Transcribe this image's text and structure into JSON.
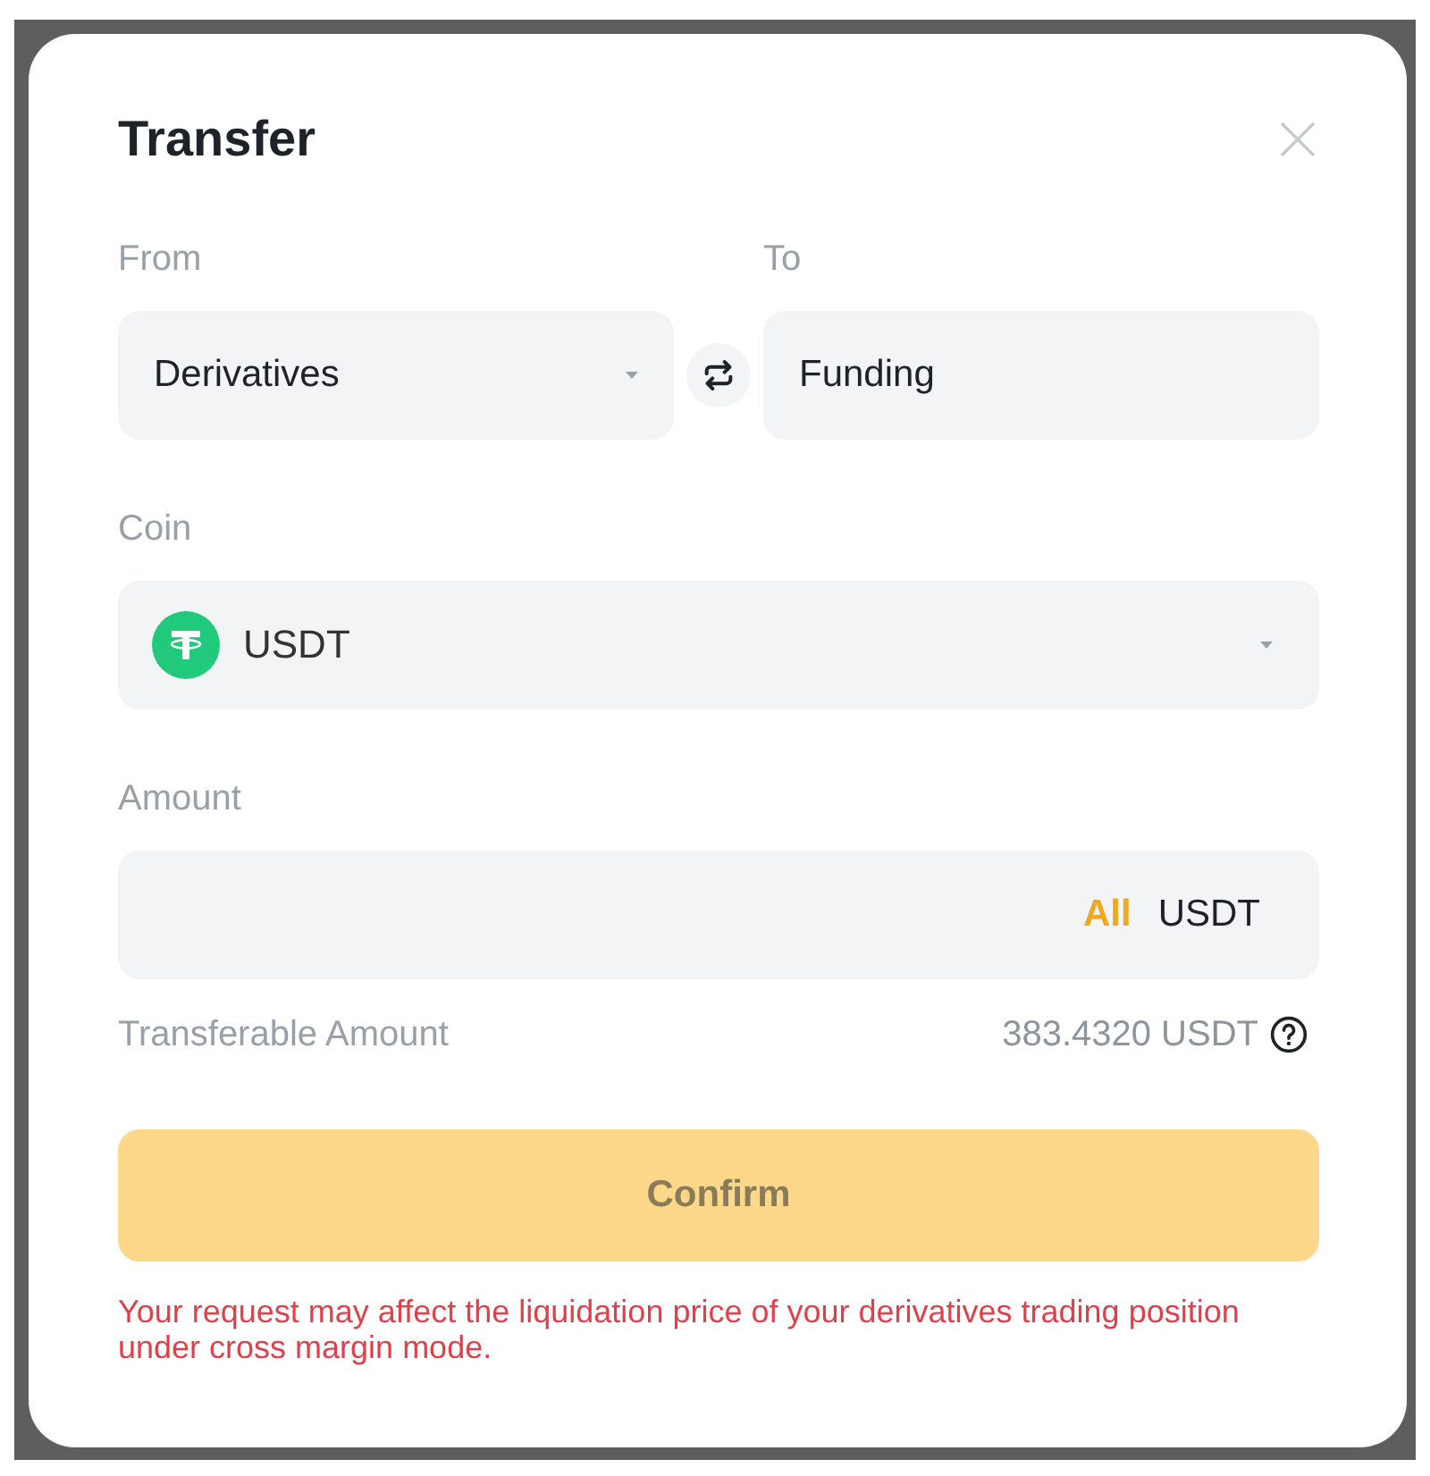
{
  "dialog": {
    "title": "Transfer",
    "from": {
      "label": "From",
      "value": "Derivatives"
    },
    "to": {
      "label": "To",
      "value": "Funding"
    },
    "coin": {
      "label": "Coin",
      "value": "USDT"
    },
    "amount": {
      "label": "Amount",
      "all_link": "All",
      "unit": "USDT"
    },
    "transferable": {
      "label": "Transferable Amount",
      "value": "383.4320 USDT"
    },
    "confirm": {
      "label": "Confirm",
      "disabled": true
    },
    "warning": "Your request may affect the liquidation price of your derivatives trading position under cross margin mode."
  }
}
